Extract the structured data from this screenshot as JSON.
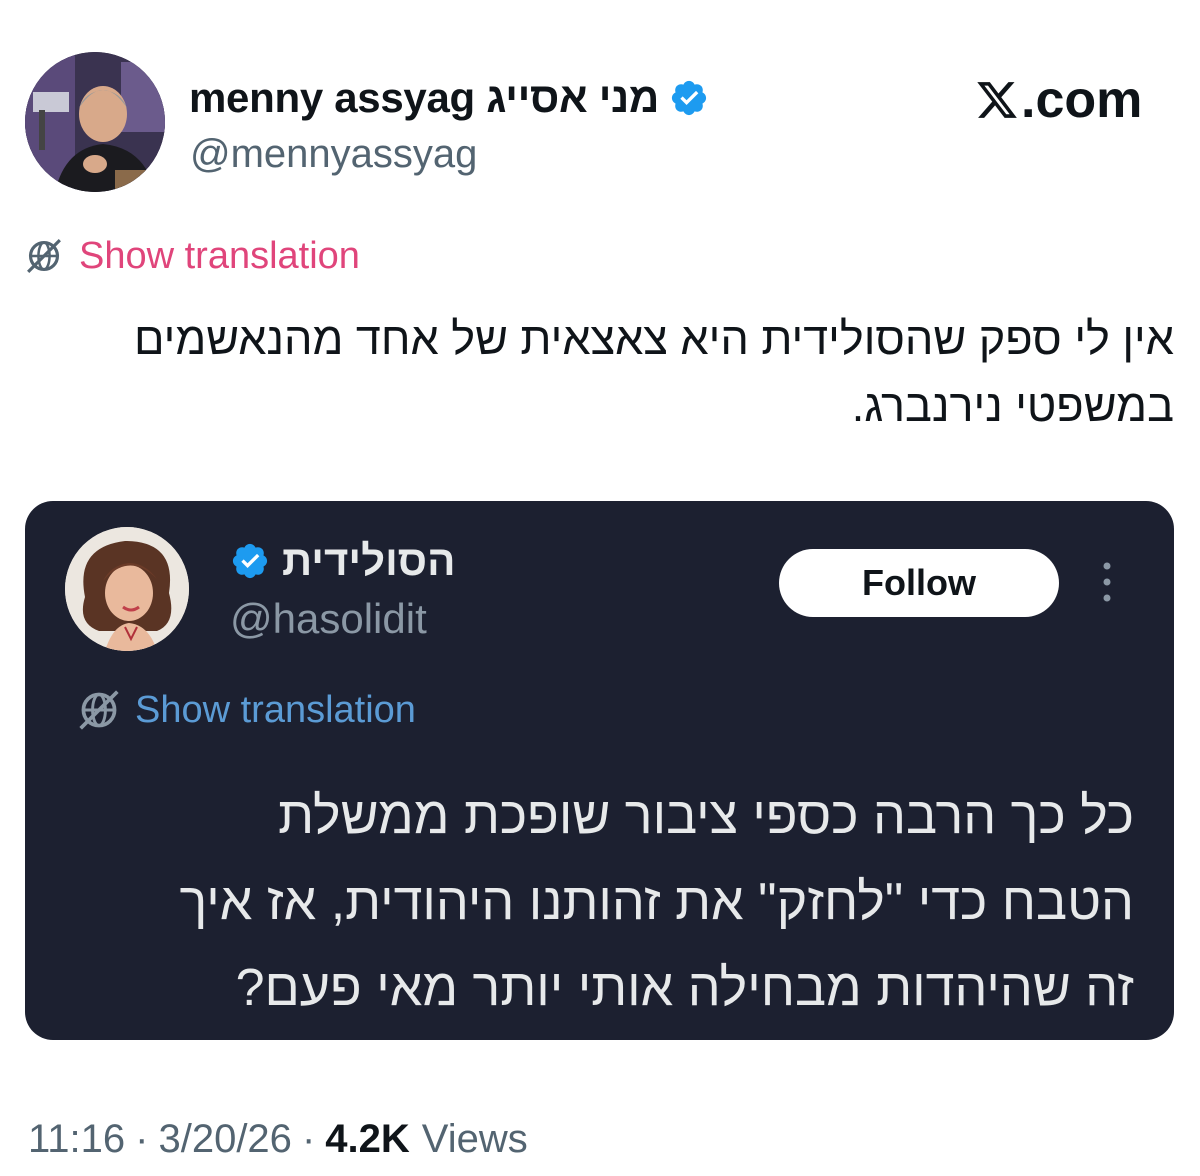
{
  "author": {
    "display_name": "menny assyag מני אסייג",
    "handle": "@mennyassyag",
    "verified": true
  },
  "site_label": ".com",
  "site_logo_icon": "x-logo-icon",
  "translate": {
    "label": "Show translation",
    "icon": "translate-globe-icon"
  },
  "tweet": {
    "lines": [
      "אין לי ספק שהסולידית היא צאצאית של אחד מהנאשמים",
      "במשפטי נירנברג."
    ]
  },
  "quoted_screenshot": {
    "display_name": "הסולידית",
    "handle": "@hasolidit",
    "verified": true,
    "follow_label": "Follow",
    "more_icon": "more-options-vertical-icon",
    "translate_label": "Show translation",
    "lines": [
      "כל כך הרבה כספי ציבור שופכת ממשלת",
      "הטבח כדי \"לחזק\" את זהותנו היהודית,  אז איך",
      "זה שהיהדות מבחילה אותי יותר מאי פעם?"
    ]
  },
  "meta": {
    "time": "11:16",
    "date": "3/20/26",
    "separator": "·",
    "views_count": "4.2K",
    "views_label": "Views"
  },
  "colors": {
    "verified_blue": "#1d9bf0",
    "translate_pink": "#e0457b",
    "card_background": "#1c2030",
    "card_translate_blue": "#5b9bd5"
  }
}
